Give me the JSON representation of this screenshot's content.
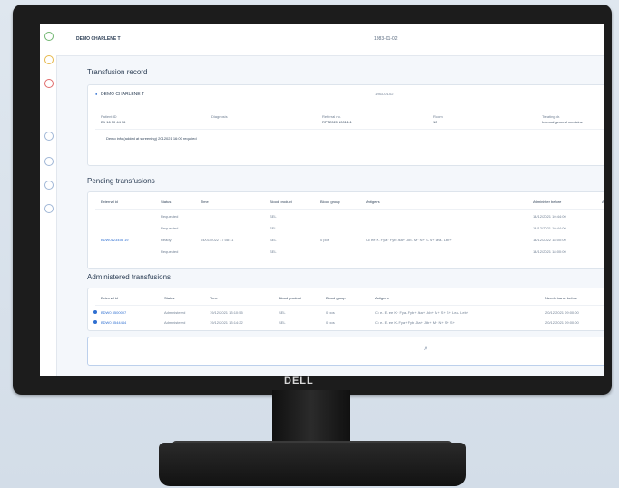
{
  "monitor": {
    "brand": "DELL"
  },
  "header": {
    "patient": "DEMO CHARLENE T",
    "dob": "1983-01-02"
  },
  "record": {
    "title": "Transfusion record",
    "patient_name": "DEMO CHARLENE T",
    "dob": "1983-01-02",
    "fields": [
      {
        "label": "Patient ID",
        "value": "D1 16 30 44 76"
      },
      {
        "label": "Diagnosis",
        "value": ""
      },
      {
        "label": "Referral no.",
        "value": "RPT2020 1001111"
      },
      {
        "label": "Room",
        "value": "10"
      },
      {
        "label": "Treating dr.",
        "value": "Internal general medicine"
      }
    ],
    "note": "Demo info (added at screening) 2012021 16:00 required"
  },
  "pending": {
    "title": "Pending transfusions",
    "columns": [
      "External id",
      "Status",
      "Time",
      "Blood product",
      "Blood group",
      "Antigens",
      "Administer before",
      "A"
    ],
    "rows": [
      {
        "id": "",
        "status": "Requested",
        "time": "",
        "product": "SEL",
        "group": "",
        "antigens": "",
        "before": "14/12/2021 10:44:00"
      },
      {
        "id": "",
        "status": "Requested",
        "time": "",
        "product": "SEL",
        "group": "",
        "antigens": "",
        "before": "14/12/2021 10:44:00"
      },
      {
        "id": "BDW0123456 19",
        "status": "Ready",
        "time": "04/01/2022 17:08:11",
        "product": "SEL",
        "group": "0 pos",
        "antigens": "Cc ee K- Fya+ Fyb Jka+ Jkb- M+ N+ S- s+ Lea- Leb+",
        "before": "14/12/2022 18:00:00"
      },
      {
        "id": "",
        "status": "Requested",
        "time": "",
        "product": "SEL",
        "group": "",
        "antigens": "",
        "before": "14/12/2021 18:00:00"
      }
    ]
  },
  "administered": {
    "title": "Administered transfusions",
    "columns": [
      "External id",
      "Status",
      "Time",
      "Blood product",
      "Blood group",
      "Antigens",
      "Needs trans. before"
    ],
    "rows": [
      {
        "id": "BDW0 3500007",
        "status": "Administered",
        "time": "19/12/2021 13:10:55",
        "product": "SEL",
        "group": "0 pos",
        "antigens": "Cc e- E- ee K+ Fya- Fyb+ Jka+ Jkb+ M+ S+ S+ Lea- Leb+",
        "before": "20/12/2021 09:00:00"
      },
      {
        "id": "BDW0 3544444",
        "status": "Administered",
        "time": "19/12/2021 13:14:22",
        "product": "SEL",
        "group": "0 pos",
        "antigens": "Cc e- E- ee K- Fya+ Fyb Jka+ Jkb+ M+ N+ S+ S+",
        "before": "20/12/2021 09:00:00"
      }
    ]
  },
  "bottom": {
    "chevron": "˄"
  },
  "colors": {
    "accent": "#2f6fd1",
    "bezel": "#1c1c1c"
  }
}
